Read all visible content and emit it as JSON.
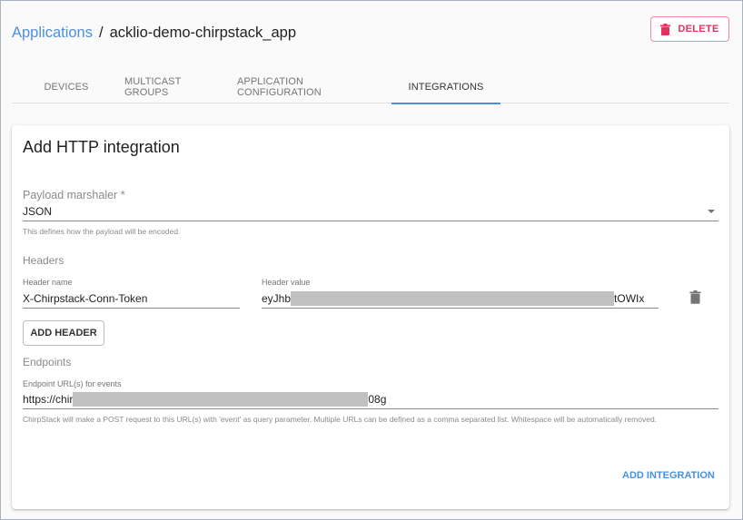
{
  "breadcrumb": {
    "parent": "Applications",
    "separator": "/",
    "current": "acklio-demo-chirpstack_app"
  },
  "actions": {
    "delete_label": "DELETE",
    "delete_icon": "trash-icon",
    "delete_color": "#e8305e"
  },
  "tabs": [
    {
      "label": "DEVICES",
      "active": false
    },
    {
      "label": "MULTICAST GROUPS",
      "active": false
    },
    {
      "label": "APPLICATION CONFIGURATION",
      "active": false
    },
    {
      "label": "INTEGRATIONS",
      "active": true
    }
  ],
  "form": {
    "title": "Add HTTP integration",
    "payload_marshaler": {
      "label": "Payload marshaler *",
      "value": "JSON",
      "helper": "This defines how the payload will be encoded."
    },
    "headers": {
      "section_label": "Headers",
      "rows": [
        {
          "name_label": "Header name",
          "name_value": "X-Chirpstack-Conn-Token",
          "value_label": "Header value",
          "value_prefix": "eyJhb",
          "value_suffix": "tOWIx",
          "value_redacted": true
        }
      ],
      "add_header_label": "ADD HEADER"
    },
    "endpoints": {
      "section_label": "Endpoints",
      "url_label": "Endpoint URL(s) for events",
      "url_prefix": "https://chir",
      "url_suffix": "08g",
      "url_redacted": true,
      "helper": "ChirpStack will make a POST request to this URL(s) with 'event' as query parameter. Multiple URLs can be defined as a comma separated list. Whitespace will be automatically removed."
    },
    "submit_label": "ADD INTEGRATION"
  },
  "colors": {
    "accent": "#4a90e2",
    "danger": "#e8305e"
  }
}
